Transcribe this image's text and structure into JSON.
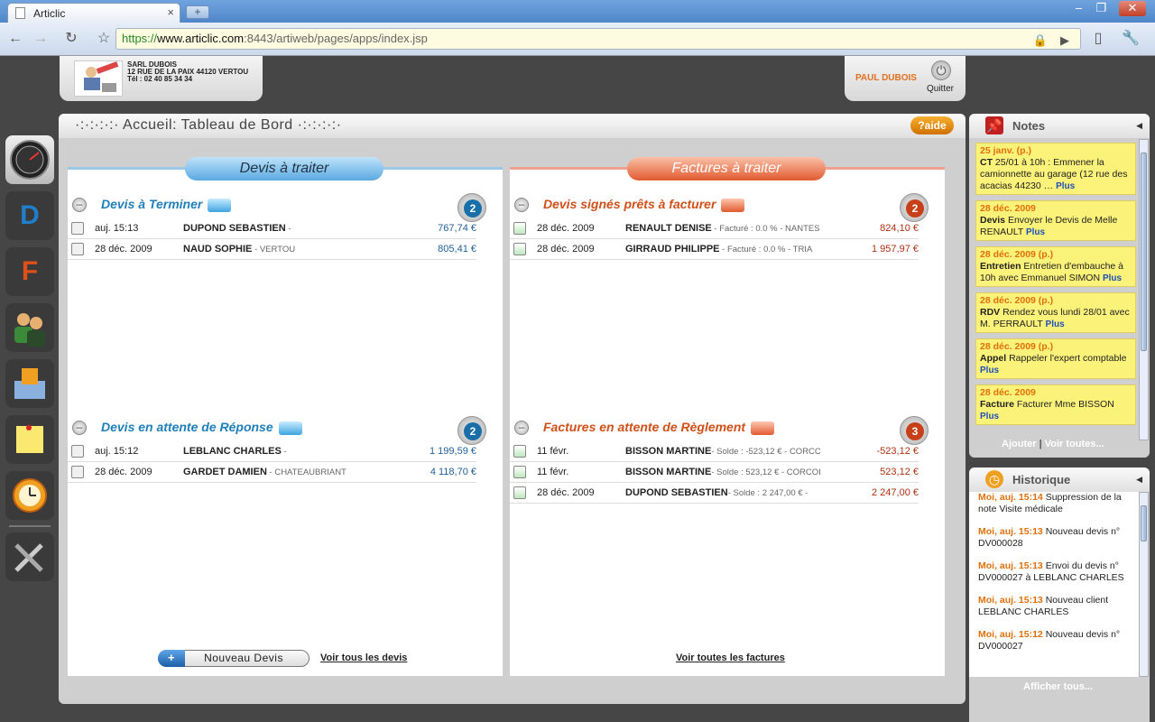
{
  "browser": {
    "tab_title": "Articlic",
    "url_scheme": "https://",
    "url_host": "www.articlic.com",
    "url_rest": ":8443/artiweb/pages/apps/index.jsp"
  },
  "header": {
    "company_name": "SARL DUBOIS",
    "company_address": "12 RUE DE LA PAIX 44120 VERTOU",
    "company_phone": "Tél : 02 40 85 34 34",
    "user_name": "PAUL DUBOIS",
    "quit_label": "Quitter"
  },
  "main": {
    "title": "·:·:·:·:· Accueil: Tableau de Bord ·:·:·:·:·",
    "help_label": "?aide"
  },
  "devis": {
    "banner": "Devis à traiter",
    "to_finish": {
      "title": "Devis à Terminer",
      "count": "2",
      "rows": [
        {
          "date": "auj. 15:13",
          "name": "DUPOND SEBASTIEN",
          "sub": " -",
          "amount": "767,74 €"
        },
        {
          "date": "28 déc. 2009",
          "name": "NAUD SOPHIE",
          "sub": " - VERTOU",
          "amount": "805,41 €"
        }
      ]
    },
    "awaiting": {
      "title": "Devis en attente de Réponse",
      "count": "2",
      "rows": [
        {
          "date": "auj. 15:12",
          "name": "LEBLANC CHARLES",
          "sub": " -",
          "amount": "1 199,59 €"
        },
        {
          "date": "28 déc. 2009",
          "name": "GARDET DAMIEN",
          "sub": " - CHATEAUBRIANT",
          "amount": "4 118,70 €"
        }
      ]
    },
    "new_button": "Nouveau Devis",
    "see_all": "Voir tous les devis"
  },
  "factures": {
    "banner": "Factures à traiter",
    "ready": {
      "title": "Devis signés prêts à facturer",
      "count": "2",
      "rows": [
        {
          "date": "28 déc. 2009",
          "name": "RENAULT DENISE",
          "sub": " - Facturé : 0.0 % - NANTES",
          "amount": "824,10 €"
        },
        {
          "date": "28 déc. 2009",
          "name": "GIRRAUD PHILIPPE",
          "sub": " - Facturé : 0.0 % - TRIA",
          "amount": "1 957,97 €"
        }
      ]
    },
    "awaiting": {
      "title": "Factures en attente de Règlement",
      "count": "3",
      "rows": [
        {
          "date": "11 févr.",
          "name": "BISSON MARTINE",
          "sub": "- Solde : -523,12 € - CORCC",
          "amount": "-523,12 €"
        },
        {
          "date": "11 févr.",
          "name": "BISSON MARTINE",
          "sub": "- Solde : 523,12 € - CORCOI",
          "amount": "523,12 €"
        },
        {
          "date": "28 déc. 2009",
          "name": "DUPOND SEBASTIEN",
          "sub": "- Solde : 2 247,00 € -",
          "amount": "2 247,00 €"
        }
      ]
    },
    "see_all": "Voir toutes les factures"
  },
  "notes": {
    "title": "Notes",
    "items": [
      {
        "date": "25 janv. (p.)",
        "type": "CT",
        "text": " 25/01 à 10h : Emmener la camionnette au garage (12 rue des acacias 44230 … ",
        "more": "Plus"
      },
      {
        "date": "28 déc. 2009",
        "type": "Devis",
        "text": " Envoyer le Devis de Melle RENAULT ",
        "more": "Plus"
      },
      {
        "date": "28 déc. 2009 (p.)",
        "type": "Entretien",
        "text": " Entretien d'embauche à 10h avec Emmanuel SIMON ",
        "more": "Plus"
      },
      {
        "date": "28 déc. 2009 (p.)",
        "type": "RDV",
        "text": " Rendez vous lundi 28/01 avec M. PERRAULT ",
        "more": "Plus"
      },
      {
        "date": "28 déc. 2009 (p.)",
        "type": "Appel",
        "text": " Rappeler l'expert comptable ",
        "more": "Plus"
      },
      {
        "date": "28 déc. 2009",
        "type": "Facture",
        "text": " Facturer Mme BISSON ",
        "more": "Plus"
      }
    ],
    "add_label": "Ajouter",
    "separator": "|",
    "see_all": "Voir toutes..."
  },
  "history": {
    "title": "Historique",
    "items": [
      {
        "date": "Moi, auj. 15:14",
        "text": " Suppression de la note Visite médicale"
      },
      {
        "date": "Moi, auj. 15:13",
        "text": " Nouveau devis n° DV000028"
      },
      {
        "date": "Moi, auj. 15:13",
        "text": " Envoi du devis n° DV000027 à LEBLANC CHARLES"
      },
      {
        "date": "Moi, auj. 15:13",
        "text": " Nouveau client LEBLANC CHARLES"
      },
      {
        "date": "Moi, auj. 15:12",
        "text": " Nouveau devis n° DV000027"
      }
    ],
    "show_all": "Afficher tous..."
  }
}
